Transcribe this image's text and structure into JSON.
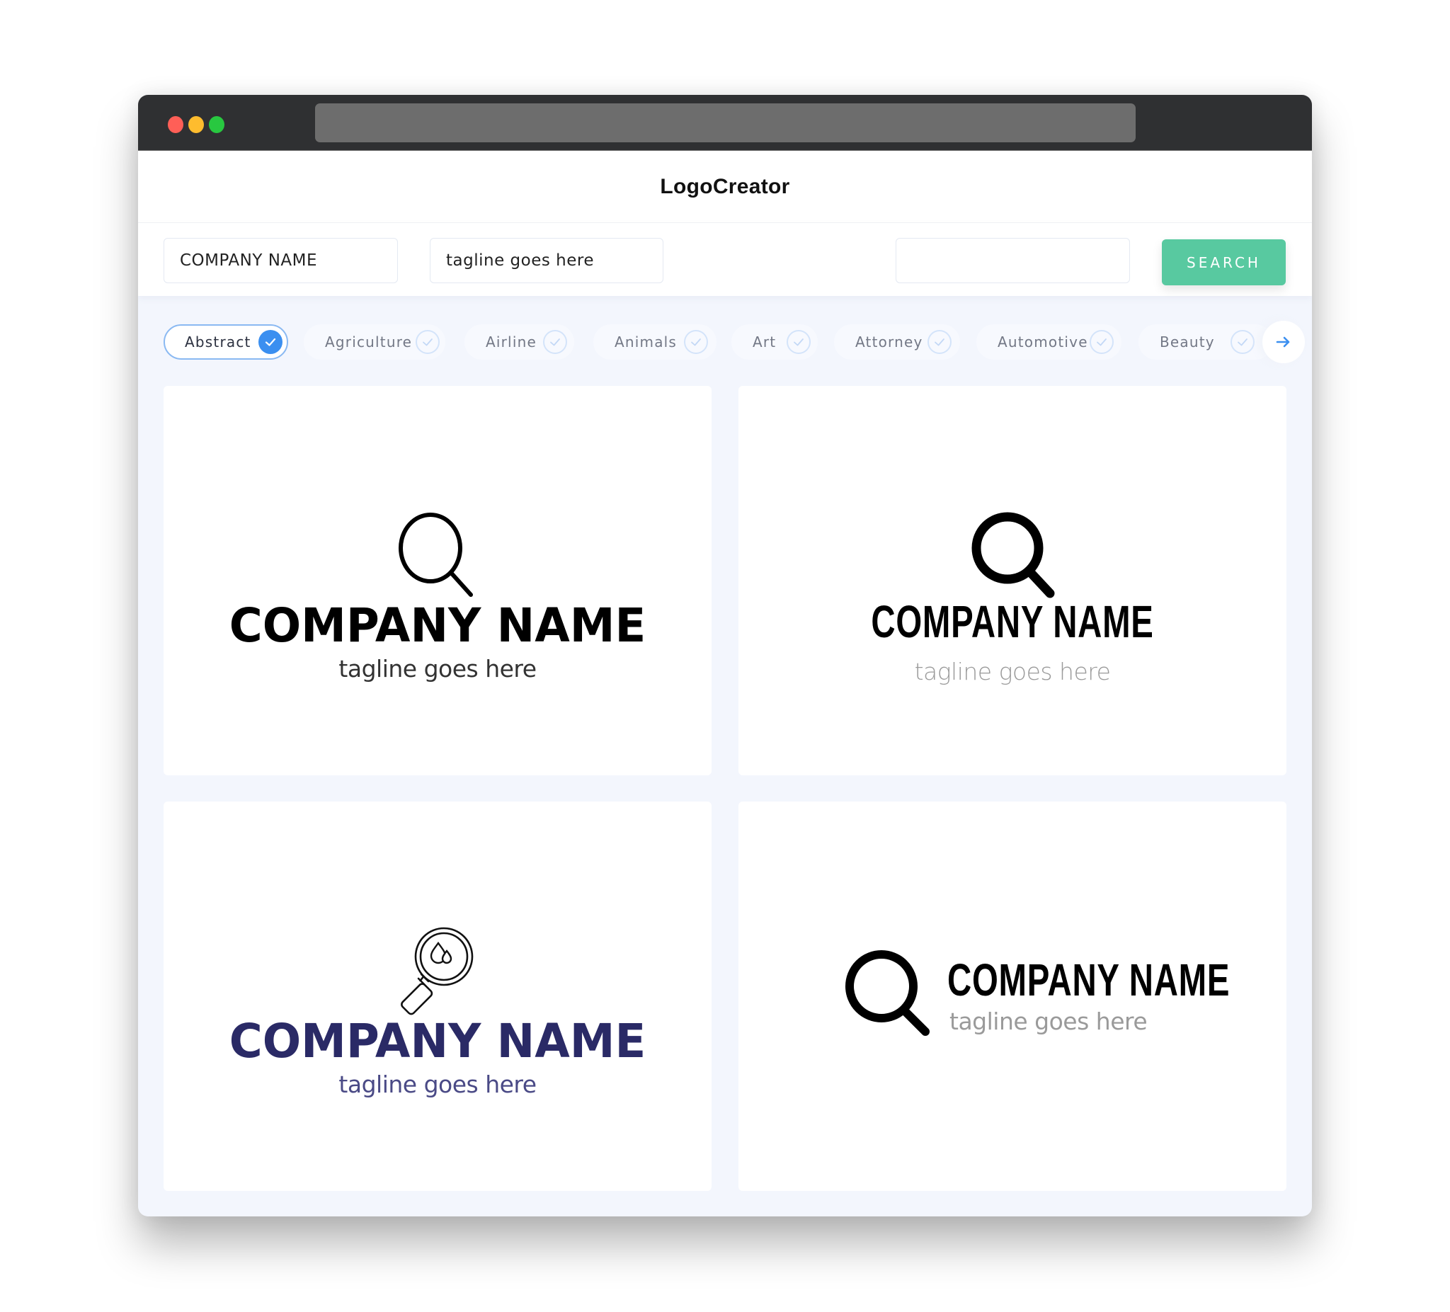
{
  "browser": {
    "traffic_lights": [
      "close",
      "minimize",
      "maximize"
    ],
    "url": ""
  },
  "app": {
    "title": "LogoCreator"
  },
  "search": {
    "company_name_value": "COMPANY NAME",
    "tagline_value": "tagline goes here",
    "keyword_value": "",
    "button_label": "SEARCH",
    "accent_color": "#58c9a0"
  },
  "categories": {
    "items": [
      {
        "label": "Abstract",
        "selected": true
      },
      {
        "label": "Agriculture",
        "selected": false
      },
      {
        "label": "Airline",
        "selected": false
      },
      {
        "label": "Animals",
        "selected": false
      },
      {
        "label": "Art",
        "selected": false
      },
      {
        "label": "Attorney",
        "selected": false
      },
      {
        "label": "Automotive",
        "selected": false
      },
      {
        "label": "Beauty",
        "selected": false
      }
    ],
    "next_icon": "arrow-right-icon",
    "selected_color": "#3b8ff0"
  },
  "logos": [
    {
      "company": "COMPANY NAME",
      "tagline": "tagline goes here",
      "icon": "magnifier-thin-icon",
      "layout": "stacked",
      "color": "#000000"
    },
    {
      "company": "COMPANY NAME",
      "tagline": "tagline goes here",
      "icon": "magnifier-bold-icon",
      "layout": "stacked",
      "color": "#000000"
    },
    {
      "company": "COMPANY NAME",
      "tagline": "tagline goes here",
      "icon": "magnifier-drops-icon",
      "layout": "stacked",
      "color": "#2a2a66"
    },
    {
      "company": "COMPANY NAME",
      "tagline": "tagline goes here",
      "icon": "magnifier-bold-icon",
      "layout": "inline",
      "color": "#000000"
    }
  ]
}
